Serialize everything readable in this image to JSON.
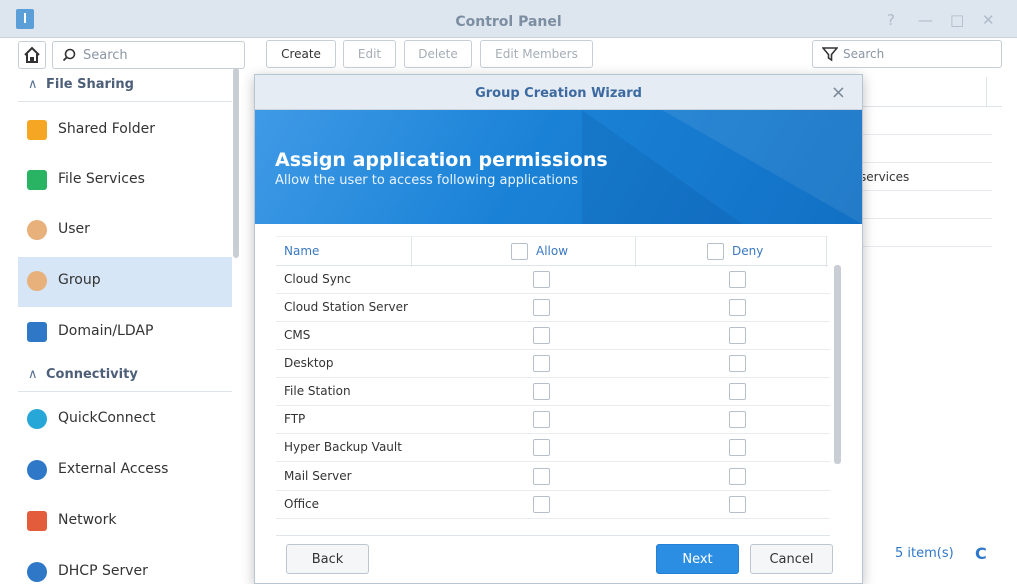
{
  "window": {
    "title": "Control Panel",
    "controls": [
      "?",
      "—",
      "□",
      "✕"
    ]
  },
  "sidebar": {
    "search_placeholder": "Search",
    "sections": [
      {
        "label": "File Sharing"
      },
      {
        "label": "Connectivity"
      }
    ],
    "items": [
      {
        "label": "Shared Folder",
        "icon": "shared-folder-icon",
        "color": "#f5a623"
      },
      {
        "label": "File Services",
        "icon": "file-services-icon",
        "color": "#28b463"
      },
      {
        "label": "User",
        "icon": "user-icon",
        "color": "#e8b07a"
      },
      {
        "label": "Group",
        "icon": "group-icon",
        "color": "#e8b07a"
      },
      {
        "label": "Domain/LDAP",
        "icon": "domain-ldap-icon",
        "color": "#2f78c8"
      },
      {
        "label": "QuickConnect",
        "icon": "quickconnect-icon",
        "color": "#27a7d8"
      },
      {
        "label": "External Access",
        "icon": "external-access-icon",
        "color": "#2f78c8"
      },
      {
        "label": "Network",
        "icon": "network-icon",
        "color": "#e35d3c"
      },
      {
        "label": "DHCP Server",
        "icon": "dhcp-server-icon",
        "color": "#2f78c8"
      }
    ],
    "active_item": "Group"
  },
  "toolbar": {
    "create": "Create",
    "edit": "Edit",
    "delete": "Delete",
    "edit_members": "Edit Members",
    "search_placeholder": "Search"
  },
  "background_table": {
    "visible_cell": "services",
    "items_count": "5 item(s)"
  },
  "wizard": {
    "title": "Group Creation Wizard",
    "heading": "Assign application permissions",
    "subheading": "Allow the user to access following applications",
    "columns": {
      "name": "Name",
      "allow": "Allow",
      "deny": "Deny"
    },
    "apps": [
      {
        "name": "Cloud Sync",
        "allow": false,
        "deny": false
      },
      {
        "name": "Cloud Station Server",
        "allow": false,
        "deny": false
      },
      {
        "name": "CMS",
        "allow": false,
        "deny": false
      },
      {
        "name": "Desktop",
        "allow": false,
        "deny": false
      },
      {
        "name": "File Station",
        "allow": false,
        "deny": false
      },
      {
        "name": "FTP",
        "allow": false,
        "deny": false
      },
      {
        "name": "Hyper Backup Vault",
        "allow": false,
        "deny": false
      },
      {
        "name": "Mail Server",
        "allow": false,
        "deny": false
      },
      {
        "name": "Office",
        "allow": false,
        "deny": false
      }
    ],
    "buttons": {
      "back": "Back",
      "next": "Next",
      "cancel": "Cancel"
    }
  }
}
